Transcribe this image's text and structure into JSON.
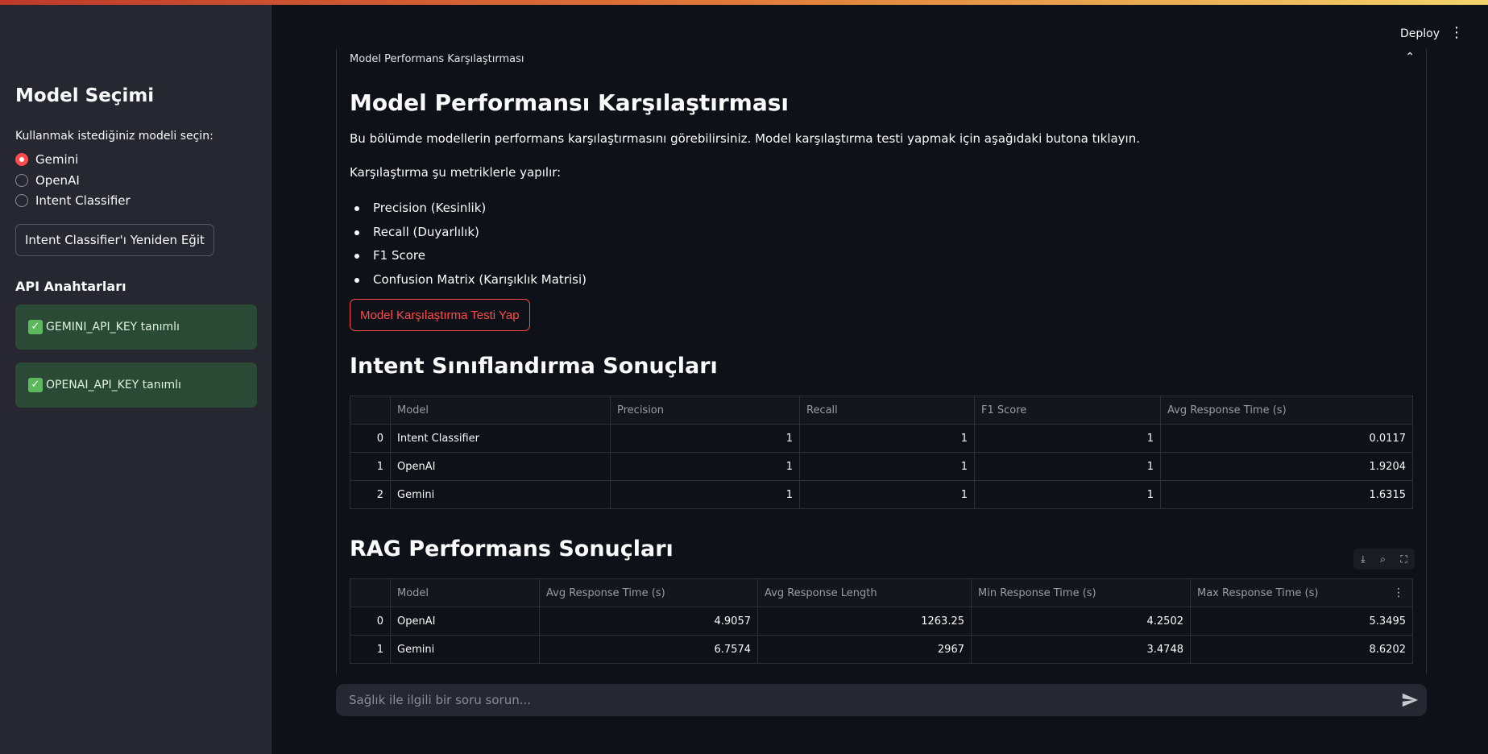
{
  "header": {
    "deploy_label": "Deploy",
    "menu_icon": "kebab-menu-icon"
  },
  "sidebar": {
    "title": "Model Seçimi",
    "radio_label": "Kullanmak istediğiniz modeli seçin:",
    "options": [
      {
        "label": "Gemini",
        "selected": true
      },
      {
        "label": "OpenAI",
        "selected": false
      },
      {
        "label": "Intent Classifier",
        "selected": false
      }
    ],
    "retrain_button": "Intent Classifier'ı Yeniden Eğit",
    "api_title": "API Anahtarları",
    "api_keys": [
      {
        "label": "GEMINI_API_KEY tanımlı"
      },
      {
        "label": "OPENAI_API_KEY tanımlı"
      }
    ],
    "success_color": "#2b4a35"
  },
  "expander": {
    "label": "Model Performans Karşılaştırması"
  },
  "main": {
    "title": "Model Performansı Karşılaştırması",
    "intro": "Bu bölümde modellerin performans karşılaştırmasını görebilirsiniz. Model karşılaştırma testi yapmak için aşağıdaki butona tıklayın.",
    "metrics_intro": "Karşılaştırma şu metriklerle yapılır:",
    "metrics": [
      "Precision (Kesinlik)",
      "Recall (Duyarlılık)",
      "F1 Score",
      "Confusion Matrix (Karışıklık Matrisi)"
    ],
    "compare_button": "Model Karşılaştırma Testi Yap",
    "accent_color": "#ff4b4b"
  },
  "intent_table": {
    "title": "Intent Sınıflandırma Sonuçları",
    "columns": [
      "",
      "Model",
      "Precision",
      "Recall",
      "F1 Score",
      "Avg Response Time (s)"
    ],
    "rows": [
      [
        "0",
        "Intent Classifier",
        "1",
        "1",
        "1",
        "0.0117"
      ],
      [
        "1",
        "OpenAI",
        "1",
        "1",
        "1",
        "1.9204"
      ],
      [
        "2",
        "Gemini",
        "1",
        "1",
        "1",
        "1.6315"
      ]
    ]
  },
  "rag_table": {
    "title": "RAG Performans Sonuçları",
    "toolbar_icons": [
      "download-icon",
      "search-icon",
      "fullscreen-icon"
    ],
    "columns": [
      "",
      "Model",
      "Avg Response Time (s)",
      "Avg Response Length",
      "Min Response Time (s)",
      "Max Response Time (s)"
    ],
    "rows": [
      [
        "0",
        "OpenAI",
        "4.9057",
        "1263.25",
        "4.2502",
        "5.3495"
      ],
      [
        "1",
        "Gemini",
        "6.7574",
        "2967",
        "3.4748",
        "8.6202"
      ]
    ]
  },
  "chat": {
    "placeholder": "Sağlık ile ilgili bir soru sorun..."
  }
}
